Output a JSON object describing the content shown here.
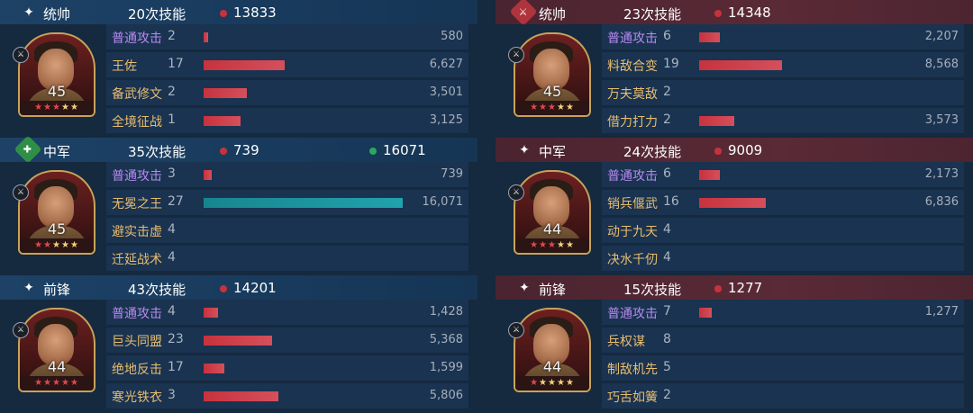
{
  "colors": {
    "ally_header": "#1d4266",
    "enemy_header": "#5a2a36",
    "skill_purple": "#b78af0",
    "skill_gold": "#e8bd70",
    "bar_red": "#c7323d",
    "bar_teal": "#18858e",
    "heal_green": "#2ba85e"
  },
  "left": [
    {
      "role": "统帅",
      "role_icon": "four-point-star-icon",
      "skill_count": "20次技能",
      "damage": "13833",
      "heal": null,
      "level": "45",
      "stars": {
        "red": 3,
        "gold": 2
      },
      "rows": [
        {
          "name": "普通攻击",
          "count": "2",
          "value": "580",
          "bar_fraction": 0.02,
          "bar": "red",
          "purple": true
        },
        {
          "name": "王佐",
          "count": "17",
          "value": "6,627",
          "bar_fraction": 0.39,
          "bar": "red",
          "purple": false
        },
        {
          "name": "备武修文",
          "count": "2",
          "value": "3,501",
          "bar_fraction": 0.21,
          "bar": "red",
          "purple": false
        },
        {
          "name": "全境征战",
          "count": "1",
          "value": "3,125",
          "bar_fraction": 0.18,
          "bar": "red",
          "purple": false
        }
      ]
    },
    {
      "role": "中军",
      "role_icon": "heart-plus-icon",
      "skill_count": "35次技能",
      "damage": "739",
      "heal": "16071",
      "level": "45",
      "stars": {
        "red": 2,
        "gold": 3
      },
      "rows": [
        {
          "name": "普通攻击",
          "count": "3",
          "value": "739",
          "bar_fraction": 0.04,
          "bar": "red",
          "purple": true
        },
        {
          "name": "无冕之王",
          "count": "27",
          "value": "16,071",
          "bar_fraction": 0.96,
          "bar": "teal",
          "purple": false
        },
        {
          "name": "避实击虚",
          "count": "4",
          "value": "",
          "bar_fraction": 0,
          "bar": "red",
          "purple": false
        },
        {
          "name": "迁延战术",
          "count": "4",
          "value": "",
          "bar_fraction": 0,
          "bar": "red",
          "purple": false
        }
      ]
    },
    {
      "role": "前锋",
      "role_icon": "four-point-star-icon",
      "skill_count": "43次技能",
      "damage": "14201",
      "heal": null,
      "level": "44",
      "stars": {
        "red": 5,
        "gold": 0
      },
      "rows": [
        {
          "name": "普通攻击",
          "count": "4",
          "value": "1,428",
          "bar_fraction": 0.07,
          "bar": "red",
          "purple": true
        },
        {
          "name": "巨头同盟",
          "count": "23",
          "value": "5,368",
          "bar_fraction": 0.33,
          "bar": "red",
          "purple": false
        },
        {
          "name": "绝地反击",
          "count": "17",
          "value": "1,599",
          "bar_fraction": 0.1,
          "bar": "red",
          "purple": false
        },
        {
          "name": "寒光铁衣",
          "count": "3",
          "value": "5,806",
          "bar_fraction": 0.36,
          "bar": "red",
          "purple": false
        }
      ]
    }
  ],
  "right": [
    {
      "role": "统帅",
      "role_icon": "crossed-swords-icon",
      "skill_count": "23次技能",
      "damage": "14348",
      "heal": null,
      "level": "45",
      "stars": {
        "red": 3,
        "gold": 2
      },
      "rows": [
        {
          "name": "普通攻击",
          "count": "6",
          "value": "2,207",
          "bar_fraction": 0.1,
          "bar": "red",
          "purple": true
        },
        {
          "name": "料敌合变",
          "count": "19",
          "value": "8,568",
          "bar_fraction": 0.4,
          "bar": "red",
          "purple": false
        },
        {
          "name": "万夫莫敌",
          "count": "2",
          "value": "",
          "bar_fraction": 0,
          "bar": "red",
          "purple": false
        },
        {
          "name": "借力打力",
          "count": "2",
          "value": "3,573",
          "bar_fraction": 0.17,
          "bar": "red",
          "purple": false
        }
      ]
    },
    {
      "role": "中军",
      "role_icon": "four-point-star-icon",
      "skill_count": "24次技能",
      "damage": "9009",
      "heal": null,
      "level": "44",
      "stars": {
        "red": 3,
        "gold": 2
      },
      "rows": [
        {
          "name": "普通攻击",
          "count": "6",
          "value": "2,173",
          "bar_fraction": 0.1,
          "bar": "red",
          "purple": true
        },
        {
          "name": "销兵偃武",
          "count": "16",
          "value": "6,836",
          "bar_fraction": 0.32,
          "bar": "red",
          "purple": false
        },
        {
          "name": "动于九天",
          "count": "4",
          "value": "",
          "bar_fraction": 0,
          "bar": "red",
          "purple": false
        },
        {
          "name": "决水千仞",
          "count": "4",
          "value": "",
          "bar_fraction": 0,
          "bar": "red",
          "purple": false
        }
      ]
    },
    {
      "role": "前锋",
      "role_icon": "four-point-star-icon",
      "skill_count": "15次技能",
      "damage": "1277",
      "heal": null,
      "level": "44",
      "stars": {
        "red": 1,
        "gold": 4
      },
      "rows": [
        {
          "name": "普通攻击",
          "count": "7",
          "value": "1,277",
          "bar_fraction": 0.06,
          "bar": "red",
          "purple": true
        },
        {
          "name": "兵权谋",
          "count": "8",
          "value": "",
          "bar_fraction": 0,
          "bar": "red",
          "purple": false
        },
        {
          "name": "制敌机先",
          "count": "5",
          "value": "",
          "bar_fraction": 0,
          "bar": "red",
          "purple": false
        },
        {
          "name": "巧舌如簧",
          "count": "2",
          "value": "",
          "bar_fraction": 0,
          "bar": "red",
          "purple": false
        }
      ]
    }
  ]
}
